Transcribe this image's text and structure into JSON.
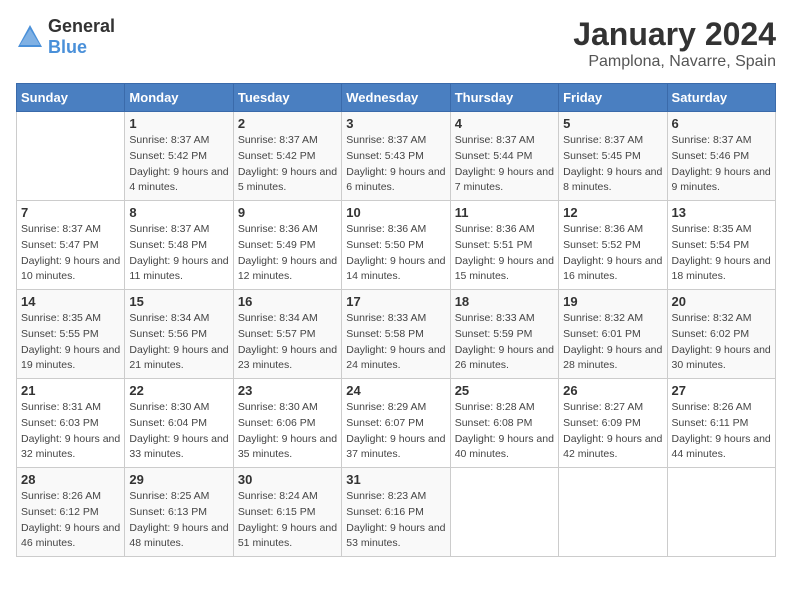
{
  "header": {
    "logo_general": "General",
    "logo_blue": "Blue",
    "month": "January 2024",
    "location": "Pamplona, Navarre, Spain"
  },
  "days_of_week": [
    "Sunday",
    "Monday",
    "Tuesday",
    "Wednesday",
    "Thursday",
    "Friday",
    "Saturday"
  ],
  "weeks": [
    [
      {
        "num": "",
        "sunrise": "",
        "sunset": "",
        "daylight": ""
      },
      {
        "num": "1",
        "sunrise": "Sunrise: 8:37 AM",
        "sunset": "Sunset: 5:42 PM",
        "daylight": "Daylight: 9 hours and 4 minutes."
      },
      {
        "num": "2",
        "sunrise": "Sunrise: 8:37 AM",
        "sunset": "Sunset: 5:42 PM",
        "daylight": "Daylight: 9 hours and 5 minutes."
      },
      {
        "num": "3",
        "sunrise": "Sunrise: 8:37 AM",
        "sunset": "Sunset: 5:43 PM",
        "daylight": "Daylight: 9 hours and 6 minutes."
      },
      {
        "num": "4",
        "sunrise": "Sunrise: 8:37 AM",
        "sunset": "Sunset: 5:44 PM",
        "daylight": "Daylight: 9 hours and 7 minutes."
      },
      {
        "num": "5",
        "sunrise": "Sunrise: 8:37 AM",
        "sunset": "Sunset: 5:45 PM",
        "daylight": "Daylight: 9 hours and 8 minutes."
      },
      {
        "num": "6",
        "sunrise": "Sunrise: 8:37 AM",
        "sunset": "Sunset: 5:46 PM",
        "daylight": "Daylight: 9 hours and 9 minutes."
      }
    ],
    [
      {
        "num": "7",
        "sunrise": "Sunrise: 8:37 AM",
        "sunset": "Sunset: 5:47 PM",
        "daylight": "Daylight: 9 hours and 10 minutes."
      },
      {
        "num": "8",
        "sunrise": "Sunrise: 8:37 AM",
        "sunset": "Sunset: 5:48 PM",
        "daylight": "Daylight: 9 hours and 11 minutes."
      },
      {
        "num": "9",
        "sunrise": "Sunrise: 8:36 AM",
        "sunset": "Sunset: 5:49 PM",
        "daylight": "Daylight: 9 hours and 12 minutes."
      },
      {
        "num": "10",
        "sunrise": "Sunrise: 8:36 AM",
        "sunset": "Sunset: 5:50 PM",
        "daylight": "Daylight: 9 hours and 14 minutes."
      },
      {
        "num": "11",
        "sunrise": "Sunrise: 8:36 AM",
        "sunset": "Sunset: 5:51 PM",
        "daylight": "Daylight: 9 hours and 15 minutes."
      },
      {
        "num": "12",
        "sunrise": "Sunrise: 8:36 AM",
        "sunset": "Sunset: 5:52 PM",
        "daylight": "Daylight: 9 hours and 16 minutes."
      },
      {
        "num": "13",
        "sunrise": "Sunrise: 8:35 AM",
        "sunset": "Sunset: 5:54 PM",
        "daylight": "Daylight: 9 hours and 18 minutes."
      }
    ],
    [
      {
        "num": "14",
        "sunrise": "Sunrise: 8:35 AM",
        "sunset": "Sunset: 5:55 PM",
        "daylight": "Daylight: 9 hours and 19 minutes."
      },
      {
        "num": "15",
        "sunrise": "Sunrise: 8:34 AM",
        "sunset": "Sunset: 5:56 PM",
        "daylight": "Daylight: 9 hours and 21 minutes."
      },
      {
        "num": "16",
        "sunrise": "Sunrise: 8:34 AM",
        "sunset": "Sunset: 5:57 PM",
        "daylight": "Daylight: 9 hours and 23 minutes."
      },
      {
        "num": "17",
        "sunrise": "Sunrise: 8:33 AM",
        "sunset": "Sunset: 5:58 PM",
        "daylight": "Daylight: 9 hours and 24 minutes."
      },
      {
        "num": "18",
        "sunrise": "Sunrise: 8:33 AM",
        "sunset": "Sunset: 5:59 PM",
        "daylight": "Daylight: 9 hours and 26 minutes."
      },
      {
        "num": "19",
        "sunrise": "Sunrise: 8:32 AM",
        "sunset": "Sunset: 6:01 PM",
        "daylight": "Daylight: 9 hours and 28 minutes."
      },
      {
        "num": "20",
        "sunrise": "Sunrise: 8:32 AM",
        "sunset": "Sunset: 6:02 PM",
        "daylight": "Daylight: 9 hours and 30 minutes."
      }
    ],
    [
      {
        "num": "21",
        "sunrise": "Sunrise: 8:31 AM",
        "sunset": "Sunset: 6:03 PM",
        "daylight": "Daylight: 9 hours and 32 minutes."
      },
      {
        "num": "22",
        "sunrise": "Sunrise: 8:30 AM",
        "sunset": "Sunset: 6:04 PM",
        "daylight": "Daylight: 9 hours and 33 minutes."
      },
      {
        "num": "23",
        "sunrise": "Sunrise: 8:30 AM",
        "sunset": "Sunset: 6:06 PM",
        "daylight": "Daylight: 9 hours and 35 minutes."
      },
      {
        "num": "24",
        "sunrise": "Sunrise: 8:29 AM",
        "sunset": "Sunset: 6:07 PM",
        "daylight": "Daylight: 9 hours and 37 minutes."
      },
      {
        "num": "25",
        "sunrise": "Sunrise: 8:28 AM",
        "sunset": "Sunset: 6:08 PM",
        "daylight": "Daylight: 9 hours and 40 minutes."
      },
      {
        "num": "26",
        "sunrise": "Sunrise: 8:27 AM",
        "sunset": "Sunset: 6:09 PM",
        "daylight": "Daylight: 9 hours and 42 minutes."
      },
      {
        "num": "27",
        "sunrise": "Sunrise: 8:26 AM",
        "sunset": "Sunset: 6:11 PM",
        "daylight": "Daylight: 9 hours and 44 minutes."
      }
    ],
    [
      {
        "num": "28",
        "sunrise": "Sunrise: 8:26 AM",
        "sunset": "Sunset: 6:12 PM",
        "daylight": "Daylight: 9 hours and 46 minutes."
      },
      {
        "num": "29",
        "sunrise": "Sunrise: 8:25 AM",
        "sunset": "Sunset: 6:13 PM",
        "daylight": "Daylight: 9 hours and 48 minutes."
      },
      {
        "num": "30",
        "sunrise": "Sunrise: 8:24 AM",
        "sunset": "Sunset: 6:15 PM",
        "daylight": "Daylight: 9 hours and 51 minutes."
      },
      {
        "num": "31",
        "sunrise": "Sunrise: 8:23 AM",
        "sunset": "Sunset: 6:16 PM",
        "daylight": "Daylight: 9 hours and 53 minutes."
      },
      {
        "num": "",
        "sunrise": "",
        "sunset": "",
        "daylight": ""
      },
      {
        "num": "",
        "sunrise": "",
        "sunset": "",
        "daylight": ""
      },
      {
        "num": "",
        "sunrise": "",
        "sunset": "",
        "daylight": ""
      }
    ]
  ]
}
